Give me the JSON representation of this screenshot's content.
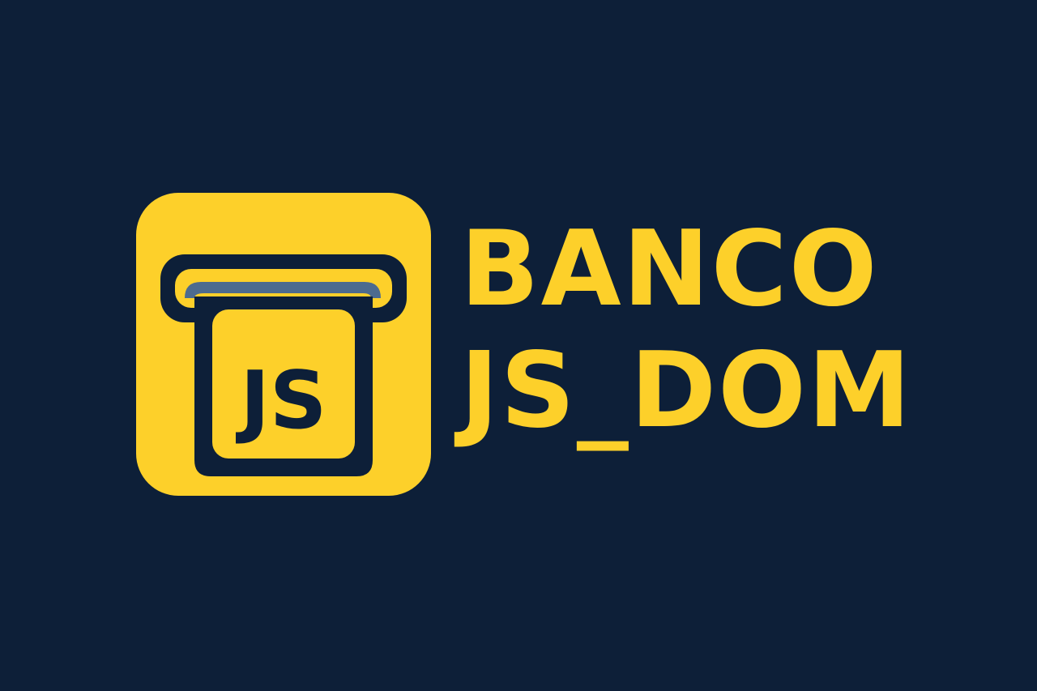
{
  "brand": {
    "name_line1": "BANCO",
    "name_line2": "JS_DOM",
    "icon_badge": "JS",
    "icon": "atm-card-slot-icon"
  },
  "colors": {
    "background": "#0d1f38",
    "accent": "#fdd02a",
    "slot": "#4d6b8f"
  }
}
